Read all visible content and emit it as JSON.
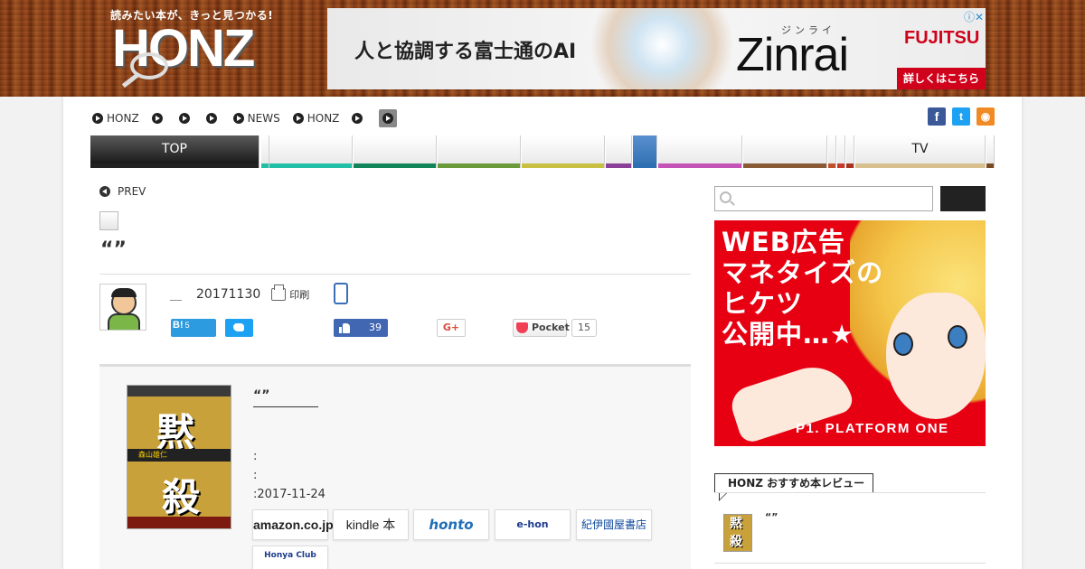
{
  "header": {
    "tagline": "読みたい本が、きっと見つかる!",
    "logo_text": "HONZ"
  },
  "top_ad": {
    "headline": "人と協調する富士通のAI",
    "ruby": "ジンライ",
    "brand": "Zinrai",
    "company": "FUJITSU",
    "cta": "詳しくはこちら",
    "choices_icon": "ⓘ✕"
  },
  "breadcrumb": {
    "items": [
      {
        "label": "HONZ"
      },
      {
        "label": ""
      },
      {
        "label": ""
      },
      {
        "label": ""
      },
      {
        "label": "NEWS"
      },
      {
        "label": "HONZ"
      },
      {
        "label": ""
      },
      {
        "label": ""
      }
    ]
  },
  "social_top": {
    "facebook": "f",
    "twitter": "t",
    "rss": "◉"
  },
  "category_nav": {
    "top_label": "TOP",
    "tv_label": "TV",
    "colors": [
      "#22bfa8",
      "#12845a",
      "#6a9a3a",
      "#c9bf40",
      "#8a3f98",
      "#2d6fb0",
      "#c552b7",
      "#8a5a35",
      "#c0502a",
      "#c8382a",
      "#a9321f",
      "#d8bf8e",
      "#7a4a1f"
    ]
  },
  "article": {
    "prev_label": "PREV",
    "title": "“”",
    "author_sep": "＿",
    "date": "20171130",
    "print_label": "印刷"
  },
  "share": {
    "hatena_label": "B!",
    "hatena_count": "5",
    "facebook_count": "39",
    "gplus_label": "G+",
    "pocket_label": "Pocket",
    "pocket_count": "15"
  },
  "book": {
    "cover_kanji_1": "黙",
    "cover_kanji_2": "殺",
    "cover_author": "森山雄仁",
    "title": "“”",
    "meta_1": ":",
    "meta_2": ":",
    "meta_3": ":2017-11-24"
  },
  "stores": {
    "amazon": "amazon.co.jp",
    "kindle": "kindle 本",
    "honto": "honto",
    "ehon": "e-hon",
    "kinokuniya": "紀伊國屋書店",
    "honya": "Honya Club"
  },
  "sidebar": {
    "search_placeholder": "",
    "ad_lines": [
      "WEB広告",
      "マネタイズの",
      "ヒケツ",
      "公開中…★"
    ],
    "ad_brand": "P1. PLATFORM ONE",
    "recommend_label": "HONZ おすすめ本レビュー",
    "recommend_item_title": "“”"
  }
}
